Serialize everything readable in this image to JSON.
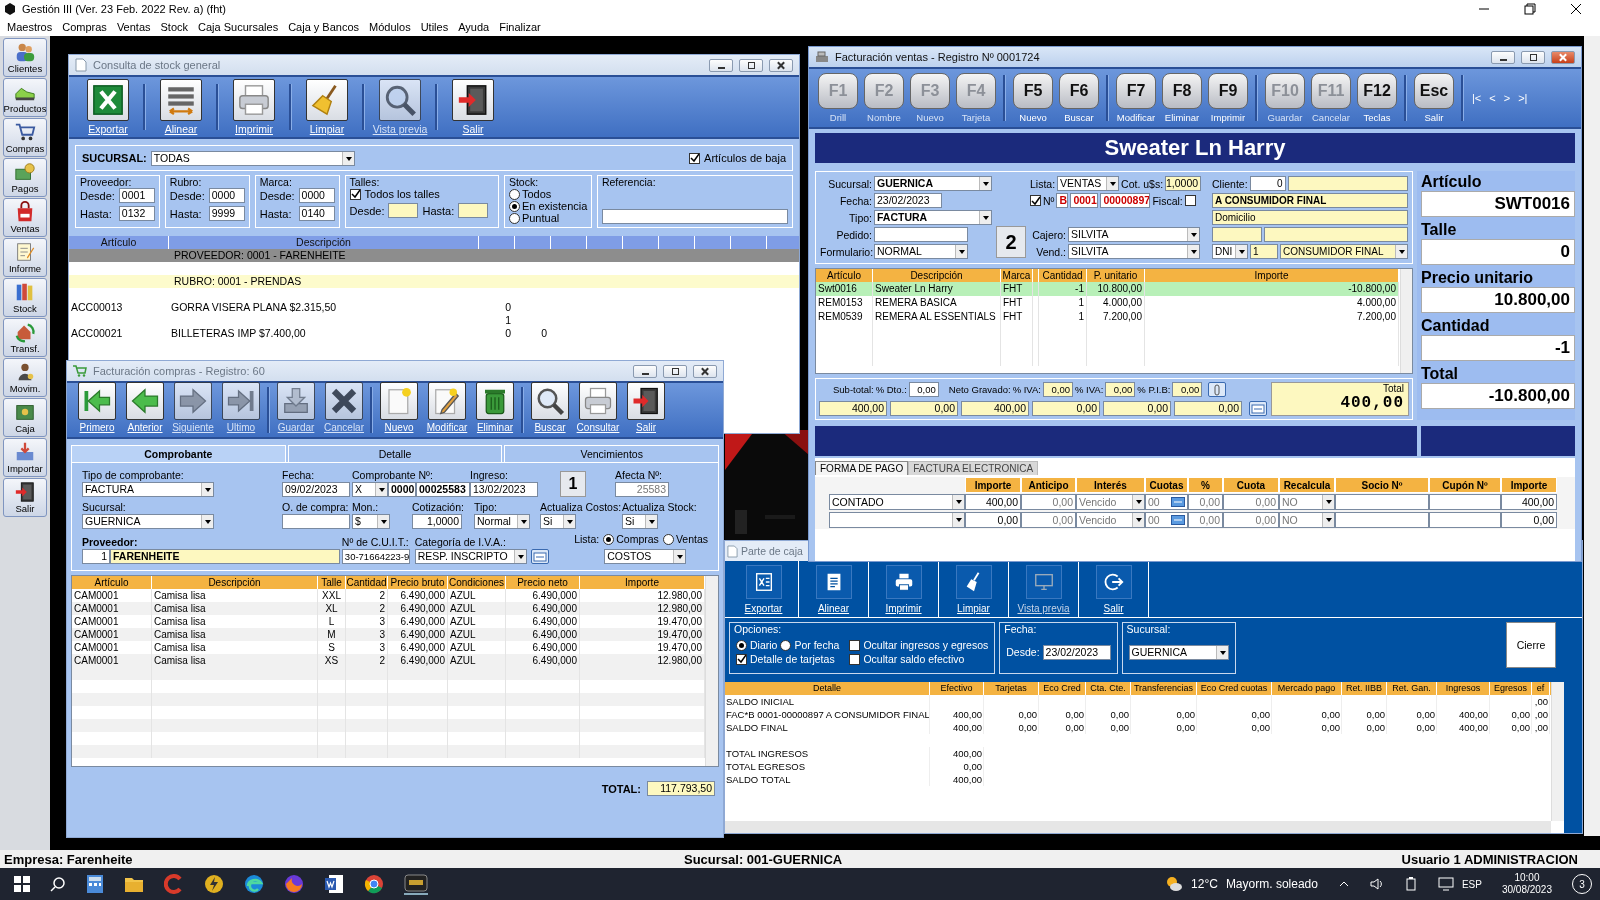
{
  "app": {
    "title": "Gestión III (Ver. 23  Feb. 2022 Rev. a) (fht)",
    "menu": [
      "Maestros",
      "Compras",
      "Ventas",
      "Stock",
      "Caja Sucursales",
      "Caja y Bancos",
      "Módulos",
      "Utiles",
      "Ayuda",
      "Finalizar"
    ]
  },
  "sidebar": [
    "Clientes",
    "Productos",
    "Compras",
    "Pagos",
    "Ventas",
    "Informe",
    "Stock",
    "Transf.",
    "Movim.",
    "Caja",
    "Importar",
    "Salir"
  ],
  "stock": {
    "title": "Consulta de stock general",
    "toolbar": [
      {
        "label": "Exportar",
        "disabled": false
      },
      {
        "label": "Alinear",
        "disabled": false
      },
      {
        "label": "Imprimir",
        "disabled": false
      },
      {
        "label": "Limpiar",
        "disabled": false
      },
      {
        "label": "Vista previa",
        "disabled": true
      },
      {
        "label": "Salir",
        "disabled": false
      }
    ],
    "sucursal": {
      "label": "SUCURSAL:",
      "value": "TODAS"
    },
    "baja": {
      "label": "Artículos de baja",
      "checked": true
    },
    "ranges": [
      {
        "label": "Proveedor:",
        "fields": [
          {
            "label": "Desde:",
            "value": "0001"
          },
          {
            "label": "Hasta:",
            "value": "0132"
          }
        ]
      },
      {
        "label": "Rubro:",
        "fields": [
          {
            "label": "Desde:",
            "value": "0000"
          },
          {
            "label": "Hasta:",
            "value": "9999"
          }
        ]
      },
      {
        "label": "Marca:",
        "fields": [
          {
            "label": "Desde:",
            "value": "0000"
          },
          {
            "label": "Hasta:",
            "value": "0140"
          }
        ]
      }
    ],
    "talles": {
      "label": "Talles:",
      "todos": {
        "label": "Todos los talles",
        "checked": true
      },
      "fields": [
        "Desde:",
        "Hasta:"
      ]
    },
    "stock_filter": {
      "label": "Stock:",
      "options": [
        {
          "label": "Todos",
          "selected": false
        },
        {
          "label": "En existencia",
          "selected": true
        },
        {
          "label": "Puntual",
          "selected": false
        }
      ]
    },
    "referencia": {
      "label": "Referencia:"
    },
    "columns": [
      "Artículo",
      "Descripción"
    ],
    "rows": [
      {
        "kind": "group",
        "text": "PROVEEDOR: 0001 - FARENHEITE"
      },
      {
        "kind": "subgroup",
        "text": "RUBRO: 0001 - PRENDAS"
      },
      {
        "kind": "item",
        "articulo": "ACC00013",
        "descripcion": "GORRA VISERA PLANA $2.315,50",
        "column_3": [
          "0",
          "1"
        ]
      },
      {
        "kind": "item",
        "articulo": "ACC00021",
        "descripcion": "BILLETERAS IMP $7.400,00",
        "column_3": [
          "0"
        ],
        "column_4": "0"
      }
    ]
  },
  "compras": {
    "title": "Facturación compras - Registro: 60",
    "toolbar": [
      {
        "label": "Primero",
        "disabled": false
      },
      {
        "label": "Anterior",
        "disabled": false
      },
      {
        "label": "Siguiente",
        "disabled": true
      },
      {
        "label": "Ultimo",
        "disabled": true
      },
      {
        "label": "Guardar",
        "disabled": true
      },
      {
        "label": "Cancelar",
        "disabled": true
      },
      {
        "label": "Nuevo",
        "disabled": false
      },
      {
        "label": "Modificar",
        "disabled": false
      },
      {
        "label": "Eliminar",
        "disabled": false
      },
      {
        "label": "Buscar",
        "disabled": false
      },
      {
        "label": "Consultar",
        "disabled": false
      },
      {
        "label": "Salir",
        "disabled": false
      }
    ],
    "tabs": [
      {
        "label": "Comprobante",
        "selected": true
      },
      {
        "label": "Detalle",
        "selected": false
      },
      {
        "label": "Vencimientos",
        "selected": false
      }
    ],
    "tipo": {
      "label": "Tipo de comprobante:",
      "value": "FACTURA"
    },
    "fecha": {
      "label": "Fecha:",
      "value": "09/02/2023"
    },
    "comprobante": {
      "label": "Comprobante Nº:",
      "letra": "X",
      "punto": "0000",
      "numero": "00025583"
    },
    "ingreso": {
      "label": "Ingreso:",
      "value": "13/02/2023"
    },
    "copias": "1",
    "afecta": {
      "label": "Afecta Nº:",
      "value": "25583"
    },
    "sucursal": {
      "label": "Sucursal:",
      "value": "GUERNICA"
    },
    "orden": {
      "label": "O. de compra:"
    },
    "moneda": {
      "label": "Mon.:",
      "value": "$"
    },
    "cotizacion": {
      "label": "Cotización:",
      "value": "1,0000"
    },
    "tipo_precio": {
      "label": "Tipo:",
      "value": "Normal"
    },
    "act_costos": {
      "label": "Actualiza Costos:",
      "value": "Si"
    },
    "act_stock": {
      "label": "Actualiza Stock:",
      "value": "Si"
    },
    "proveedor": {
      "label": "Proveedor:",
      "code": "1",
      "name": "FARENHEITE"
    },
    "cuit": {
      "label": "Nº de C.U.I.T.:",
      "value": "30-71664223-9"
    },
    "iva": {
      "label": "Categoría de I.V.A.:",
      "value": "RESP. INSCRIPTO"
    },
    "lista": {
      "label": "Lista:",
      "options": [
        {
          "label": "Compras",
          "selected": true
        },
        {
          "label": "Ventas",
          "selected": false
        }
      ],
      "value": "COSTOS"
    },
    "columns": [
      "Artículo",
      "Descripción",
      "Talle",
      "Cantidad",
      "Precio bruto",
      "Condiciones",
      "Precio neto",
      "Importe"
    ],
    "rows": [
      [
        "CAM0001",
        "Camisa lisa",
        "XXL",
        "2",
        "6.490,000",
        "AZUL",
        "6.490,000",
        "12.980,00"
      ],
      [
        "CAM0001",
        "Camisa lisa",
        "XL",
        "2",
        "6.490,000",
        "AZUL",
        "6.490,000",
        "12.980,00"
      ],
      [
        "CAM0001",
        "Camisa lisa",
        "L",
        "3",
        "6.490,000",
        "AZUL",
        "6.490,000",
        "19.470,00"
      ],
      [
        "CAM0001",
        "Camisa lisa",
        "M",
        "3",
        "6.490,000",
        "AZUL",
        "6.490,000",
        "19.470,00"
      ],
      [
        "CAM0001",
        "Camisa lisa",
        "S",
        "3",
        "6.490,000",
        "AZUL",
        "6.490,000",
        "19.470,00"
      ],
      [
        "CAM0001",
        "Camisa lisa",
        "XS",
        "2",
        "6.490,000",
        "AZUL",
        "6.490,000",
        "12.980,00"
      ]
    ],
    "total": {
      "label": "TOTAL:",
      "value": "117.793,50"
    }
  },
  "ventas": {
    "title": "Facturación ventas - Registro Nº 0001724",
    "fkeys": [
      {
        "key": "F1",
        "label": "Drill",
        "disabled": true
      },
      {
        "key": "F2",
        "label": "Nombre",
        "disabled": true
      },
      {
        "key": "F3",
        "label": "Nuevo",
        "disabled": true
      },
      {
        "key": "F4",
        "label": "Tarjeta",
        "disabled": true
      },
      {
        "key": "F5",
        "label": "Nuevo",
        "disabled": false
      },
      {
        "key": "F6",
        "label": "Buscar",
        "disabled": false
      },
      {
        "key": "F7",
        "label": "Modificar",
        "disabled": false
      },
      {
        "key": "F8",
        "label": "Eliminar",
        "disabled": false
      },
      {
        "key": "F9",
        "label": "Imprimir",
        "disabled": false
      },
      {
        "key": "F10",
        "label": "Guardar",
        "disabled": true
      },
      {
        "key": "F11",
        "label": "Cancelar",
        "disabled": true
      },
      {
        "key": "F12",
        "label": "Teclas",
        "disabled": false
      },
      {
        "key": "Esc",
        "label": "Salir",
        "disabled": false
      }
    ],
    "nav": [
      "|<",
      "<",
      ">",
      ">|"
    ],
    "banner": "Sweater Ln Harry",
    "sucursal": {
      "label": "Sucursal:",
      "value": "GUERNICA"
    },
    "fecha": {
      "label": "Fecha:",
      "value": "23/02/2023"
    },
    "tipo": {
      "label": "Tipo:",
      "value": "FACTURA"
    },
    "pedido": {
      "label": "Pedido:"
    },
    "formulario": {
      "label": "Formulario:",
      "value": "NORMAL"
    },
    "copias": "2",
    "lista": {
      "label": "Lista:",
      "value": "VENTAS"
    },
    "cot": {
      "label": "Cot. u$s:",
      "value": "1,0000"
    },
    "numero": {
      "label": "Nº",
      "checked": true,
      "letra": "B",
      "punto": "0001",
      "numero": "00000897"
    },
    "fiscal": {
      "label": "Fiscal:",
      "checked": false
    },
    "cajero": {
      "label": "Cajero:",
      "value": "SILVITA"
    },
    "vendedor": {
      "label": "Vend.:",
      "value": "SILVITA"
    },
    "cliente": {
      "label": "Cliente:",
      "code": "0",
      "name": "A CONSUMIDOR FINAL",
      "domicilio": "Domicilio",
      "doc_tipo": "DNI",
      "doc": "1",
      "condicion": "CONSUMIDOR FINAL"
    },
    "columns": [
      "Artículo",
      "Descripción",
      "Marca",
      "Cantidad",
      "P. unitario",
      "Importe"
    ],
    "rows": [
      {
        "cells": [
          "Swt0016",
          "Sweater Ln Harry",
          "FHT",
          "-1",
          "10.800,00",
          "-10.800,00"
        ],
        "selected": true
      },
      {
        "cells": [
          "REM0153",
          "REMERA BASICA",
          "FHT",
          "1",
          "4.000,00",
          "4.000,00"
        ],
        "selected": false
      },
      {
        "cells": [
          "REM0539",
          "REMERA AL ESSENTIALS",
          "FHT",
          "1",
          "7.200,00",
          "7.200,00"
        ],
        "selected": false
      }
    ],
    "totales": {
      "labels": [
        "Sub-total:",
        "% Dto.:",
        "Neto Gravado:",
        "% IVA:",
        "% IVA:",
        "% P.I.B:"
      ],
      "rates": [
        "0,00",
        "0,00",
        "0,00",
        "0,00"
      ],
      "amounts": [
        "400,00",
        "0,00",
        "400,00",
        "0,00",
        "0,00",
        "0,00"
      ],
      "total_label": "Total",
      "total": "400,00"
    },
    "panel": [
      {
        "label": "Artículo",
        "value": "SWT0016"
      },
      {
        "label": "Talle",
        "value": "0"
      },
      {
        "label": "Precio unitario",
        "value": "10.800,00"
      },
      {
        "label": "Cantidad",
        "value": "-1"
      },
      {
        "label": "Total",
        "value": "-10.800,00"
      }
    ],
    "tabs": [
      {
        "label": "FORMA DE PAGO",
        "selected": true
      },
      {
        "label": "FACTURA ELECTRONICA",
        "selected": false
      }
    ],
    "pay_columns": [
      "Importe",
      "Anticipo",
      "Interés",
      "Cuotas",
      "%",
      "Cuota",
      "Recalcula",
      "Socio Nº",
      "Cupón Nº",
      "Importe"
    ],
    "payments": [
      {
        "forma": "CONTADO",
        "importe": "400,00",
        "anticipo": "0,00",
        "interes": "Vencido",
        "cuotas": "00",
        "pct": "0,00",
        "cuota": "0,00",
        "recalcula": "NO",
        "total": "400,00"
      },
      {
        "importe": "0,00",
        "anticipo": "0,00",
        "interes": "Vencido",
        "cuotas": "00",
        "pct": "0,00",
        "cuota": "0,00",
        "recalcula": "NO",
        "total": "0,00"
      }
    ]
  },
  "caja": {
    "title": "Parte de caja",
    "toolbar": [
      {
        "label": "Exportar",
        "disabled": false
      },
      {
        "label": "Alinear",
        "disabled": false
      },
      {
        "label": "Imprimir",
        "disabled": false
      },
      {
        "label": "Limpiar",
        "disabled": false
      },
      {
        "label": "Vista previa",
        "disabled": true
      },
      {
        "label": "Salir",
        "disabled": false
      }
    ],
    "opciones": {
      "label": "Opciones:",
      "radios": [
        {
          "label": "Diario",
          "selected": true
        },
        {
          "label": "Por fecha",
          "selected": false
        }
      ],
      "checks": [
        {
          "label": "Detalle de tarjetas",
          "checked": true
        },
        {
          "label": "Ocultar ingresos y egresos",
          "checked": false
        },
        {
          "label": "Ocultar saldo efectivo",
          "checked": false
        }
      ]
    },
    "fecha": {
      "label": "Fecha:",
      "desde_label": "Desde:",
      "value": "23/02/2023"
    },
    "sucursal": {
      "label": "Sucursal:",
      "value": "GUERNICA"
    },
    "cierre": "Cierre",
    "columns": [
      "Detalle",
      "Efectivo",
      "Tarjetas",
      "Eco Cred",
      "Cta. Cte.",
      "Transferencias",
      "Eco Cred cuotas",
      "Mercado pago",
      "Ret. IIBB",
      "Ret. Gan.",
      "Ingresos",
      "Egresos",
      "ef"
    ],
    "rows": [
      [
        "SALDO INICIAL",
        "",
        "",
        "",
        "",
        "",
        "",
        "",
        "",
        "",
        "",
        "",
        ",00"
      ],
      [
        "FAC*B 0001-00000897 A CONSUMIDOR FINAL",
        "400,00",
        "0,00",
        "0,00",
        "0,00",
        "0,00",
        "0,00",
        "0,00",
        "0,00",
        "0,00",
        "400,00",
        "0,00",
        ",00"
      ],
      [
        "SALDO FINAL",
        "400,00",
        "0,00",
        "0,00",
        "0,00",
        "0,00",
        "0,00",
        "0,00",
        "0,00",
        "0,00",
        "400,00",
        "0,00",
        ",00"
      ],
      [],
      [
        "TOTAL INGRESOS",
        "400,00"
      ],
      [
        "TOTAL EGRESOS",
        "0,00"
      ],
      [
        "SALDO TOTAL",
        "400,00"
      ]
    ]
  },
  "status": {
    "empresa": "Empresa: Farenheite",
    "sucursal": "Sucursal: 001-GUERNICA",
    "usuario": "Usuario 1 ADMINISTRACION"
  },
  "taskbar": {
    "weather": "12°C",
    "weather_text": "Mayorm. soleado",
    "lang": "ESP",
    "time": "10:00",
    "date": "30/08/2023",
    "notifications": "3"
  }
}
